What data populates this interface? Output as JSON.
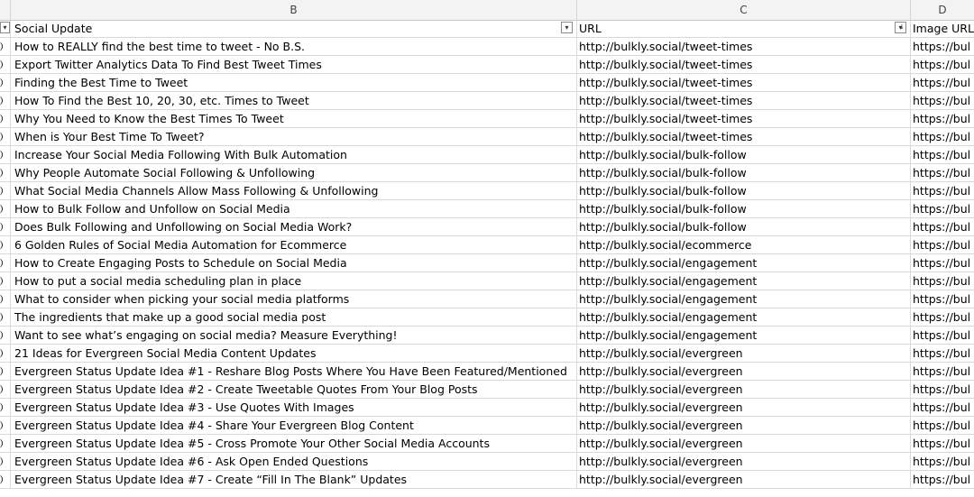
{
  "columns": {
    "b": "B",
    "c": "C",
    "d": "D"
  },
  "header": {
    "b": "Social Update",
    "c": "URL",
    "d": "Image URL"
  },
  "icons": {
    "filter": "dropdown-arrow-icon",
    "sorted_filter": "sort-filter-icon"
  },
  "rows": [
    {
      "update": "How to REALLY find the best time to tweet - No B.S.",
      "url": "http://bulkly.social/tweet-times",
      "image": "https://bul"
    },
    {
      "update": "Export Twitter Analytics Data To Find Best Tweet Times",
      "url": "http://bulkly.social/tweet-times",
      "image": "https://bul"
    },
    {
      "update": "Finding the Best Time to Tweet",
      "url": "http://bulkly.social/tweet-times",
      "image": "https://bul"
    },
    {
      "update": "How To Find the Best 10, 20, 30, etc. Times to Tweet",
      "url": "http://bulkly.social/tweet-times",
      "image": "https://bul"
    },
    {
      "update": "Why You Need to Know the Best Times To Tweet",
      "url": "http://bulkly.social/tweet-times",
      "image": "https://bul"
    },
    {
      "update": "When is Your Best Time To Tweet?",
      "url": "http://bulkly.social/tweet-times",
      "image": "https://bul"
    },
    {
      "update": "Increase Your Social Media Following With Bulk Automation",
      "url": "http://bulkly.social/bulk-follow",
      "image": "https://bul"
    },
    {
      "update": "Why People Automate Social Following & Unfollowing",
      "url": "http://bulkly.social/bulk-follow",
      "image": "https://bul"
    },
    {
      "update": "What Social Media Channels Allow Mass Following & Unfollowing",
      "url": "http://bulkly.social/bulk-follow",
      "image": "https://bul"
    },
    {
      "update": "How to Bulk Follow and Unfollow on Social Media",
      "url": "http://bulkly.social/bulk-follow",
      "image": "https://bul"
    },
    {
      "update": "Does Bulk Following and Unfollowing on Social Media Work?",
      "url": "http://bulkly.social/bulk-follow",
      "image": "https://bul"
    },
    {
      "update": "6 Golden Rules of Social Media Automation for Ecommerce",
      "url": "http://bulkly.social/ecommerce",
      "image": "https://bul"
    },
    {
      "update": "How to Create Engaging Posts to Schedule on Social Media",
      "url": "http://bulkly.social/engagement",
      "image": "https://bul"
    },
    {
      "update": "How to put a social media scheduling plan in place",
      "url": "http://bulkly.social/engagement",
      "image": "https://bul"
    },
    {
      "update": "What to consider when picking your social media platforms",
      "url": "http://bulkly.social/engagement",
      "image": "https://bul"
    },
    {
      "update": "The ingredients that make up a good social media post",
      "url": "http://bulkly.social/engagement",
      "image": "https://bul"
    },
    {
      "update": "Want to see what’s engaging on social media? Measure Everything!",
      "url": "http://bulkly.social/engagement",
      "image": "https://bul"
    },
    {
      "update": "21 Ideas for Evergreen Social Media Content Updates",
      "url": "http://bulkly.social/evergreen",
      "image": "https://bul"
    },
    {
      "update": "Evergreen Status Update Idea #1 - Reshare Blog Posts Where You Have Been Featured/Mentioned",
      "url": "http://bulkly.social/evergreen",
      "image": "https://bul"
    },
    {
      "update": "Evergreen Status Update Idea #2 - Create Tweetable Quotes From Your Blog Posts",
      "url": "http://bulkly.social/evergreen",
      "image": "https://bul"
    },
    {
      "update": "Evergreen Status Update Idea #3 - Use Quotes With Images",
      "url": "http://bulkly.social/evergreen",
      "image": "https://bul"
    },
    {
      "update": "Evergreen Status Update Idea #4 - Share Your Evergreen Blog Content",
      "url": "http://bulkly.social/evergreen",
      "image": "https://bul"
    },
    {
      "update": "Evergreen Status Update Idea #5 - Cross Promote Your Other Social Media Accounts",
      "url": "http://bulkly.social/evergreen",
      "image": "https://bul"
    },
    {
      "update": "Evergreen Status Update Idea #6 - Ask Open Ended Questions",
      "url": "http://bulkly.social/evergreen",
      "image": "https://bul"
    },
    {
      "update": "Evergreen Status Update Idea #7 - Create “Fill In The Blank” Updates",
      "url": "http://bulkly.social/evergreen",
      "image": "https://bul"
    }
  ]
}
